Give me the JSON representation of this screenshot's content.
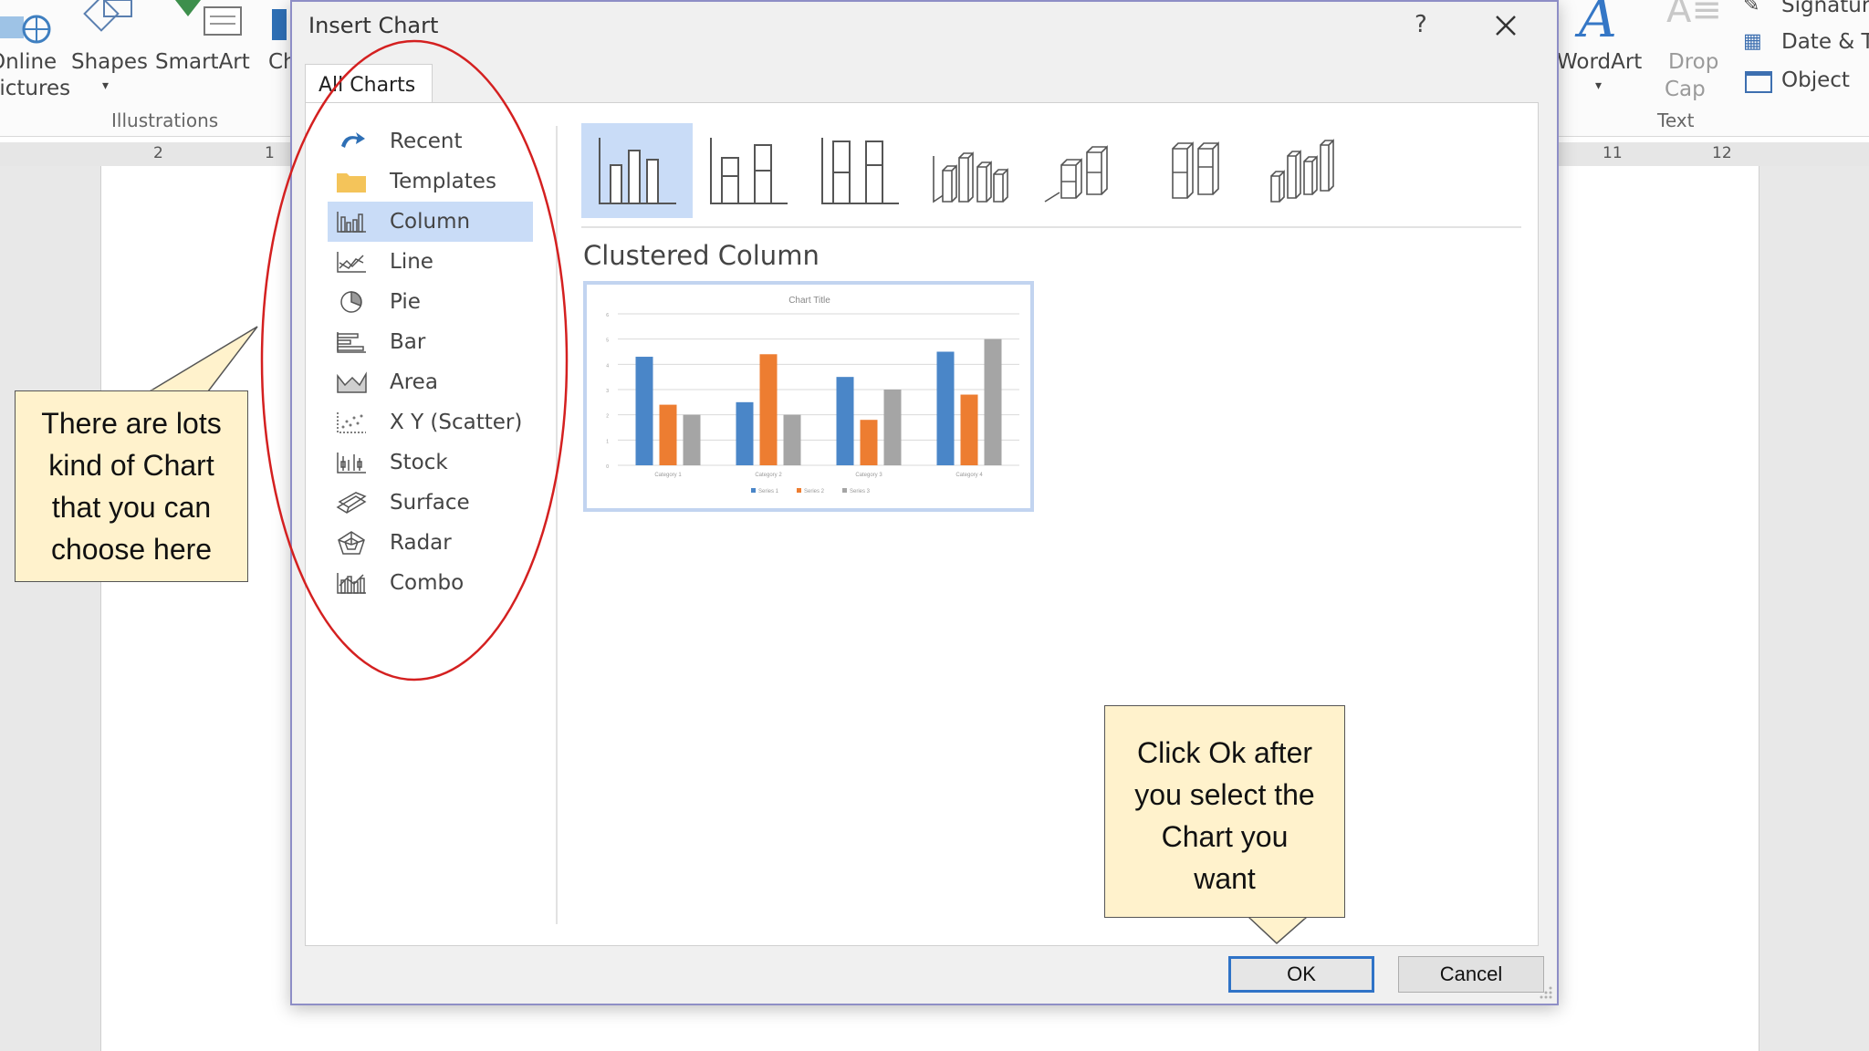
{
  "ribbon": {
    "online_pictures_line1": "Online",
    "online_pictures_line2": "Pictures",
    "shapes": "Shapes",
    "smartart": "SmartArt",
    "chart_partial": "Ch",
    "illustrations_group": "Illustrations",
    "wordart": "WordArt",
    "drop_cap_line1": "Drop",
    "drop_cap_line2": "Cap",
    "signature": "Signatur",
    "date_time": "Date & T",
    "object": "Object",
    "text_group": "Text"
  },
  "ruler": {
    "left_numbers": [
      "2",
      "1"
    ],
    "right_numbers": [
      "11",
      "12"
    ]
  },
  "dialog": {
    "title": "Insert Chart",
    "help": "?",
    "tab": "All Charts",
    "chart_types": [
      {
        "label": "Recent",
        "icon": "recent-icon"
      },
      {
        "label": "Templates",
        "icon": "templates-folder-icon"
      },
      {
        "label": "Column",
        "icon": "column-chart-icon"
      },
      {
        "label": "Line",
        "icon": "line-chart-icon"
      },
      {
        "label": "Pie",
        "icon": "pie-chart-icon"
      },
      {
        "label": "Bar",
        "icon": "bar-chart-icon"
      },
      {
        "label": "Area",
        "icon": "area-chart-icon"
      },
      {
        "label": "X Y (Scatter)",
        "icon": "scatter-chart-icon"
      },
      {
        "label": "Stock",
        "icon": "stock-chart-icon"
      },
      {
        "label": "Surface",
        "icon": "surface-chart-icon"
      },
      {
        "label": "Radar",
        "icon": "radar-chart-icon"
      },
      {
        "label": "Combo",
        "icon": "combo-chart-icon"
      }
    ],
    "selected_type": "Column",
    "subtypes": [
      "clustered-column",
      "stacked-column",
      "100-stacked-column",
      "3d-clustered-column",
      "3d-stacked-column",
      "3d-100-stacked-column",
      "3d-column"
    ],
    "selected_subtype": "Clustered Column",
    "ok": "OK",
    "cancel": "Cancel"
  },
  "preview_chart": {
    "title": "Chart Title",
    "categories": [
      "Category 1",
      "Category 2",
      "Category 3",
      "Category 4"
    ],
    "series": [
      {
        "name": "Series 1",
        "color": "#4a86c8",
        "values": [
          4.3,
          2.5,
          3.5,
          4.5
        ]
      },
      {
        "name": "Series 2",
        "color": "#ed7d31",
        "values": [
          2.4,
          4.4,
          1.8,
          2.8
        ]
      },
      {
        "name": "Series 3",
        "color": "#a5a5a5",
        "values": [
          2.0,
          2.0,
          3.0,
          5.0
        ]
      }
    ]
  },
  "callouts": {
    "left": [
      "There are lots",
      "kind of Chart",
      "that you can",
      "choose here"
    ],
    "right": [
      "Click Ok after",
      "you select the",
      "Chart you",
      "want"
    ]
  },
  "colors": {
    "accent": "#c9dcf7",
    "annotation_ellipse": "#d42020",
    "callout_fill": "#fff2cc",
    "ok_border": "#2f73c7"
  }
}
